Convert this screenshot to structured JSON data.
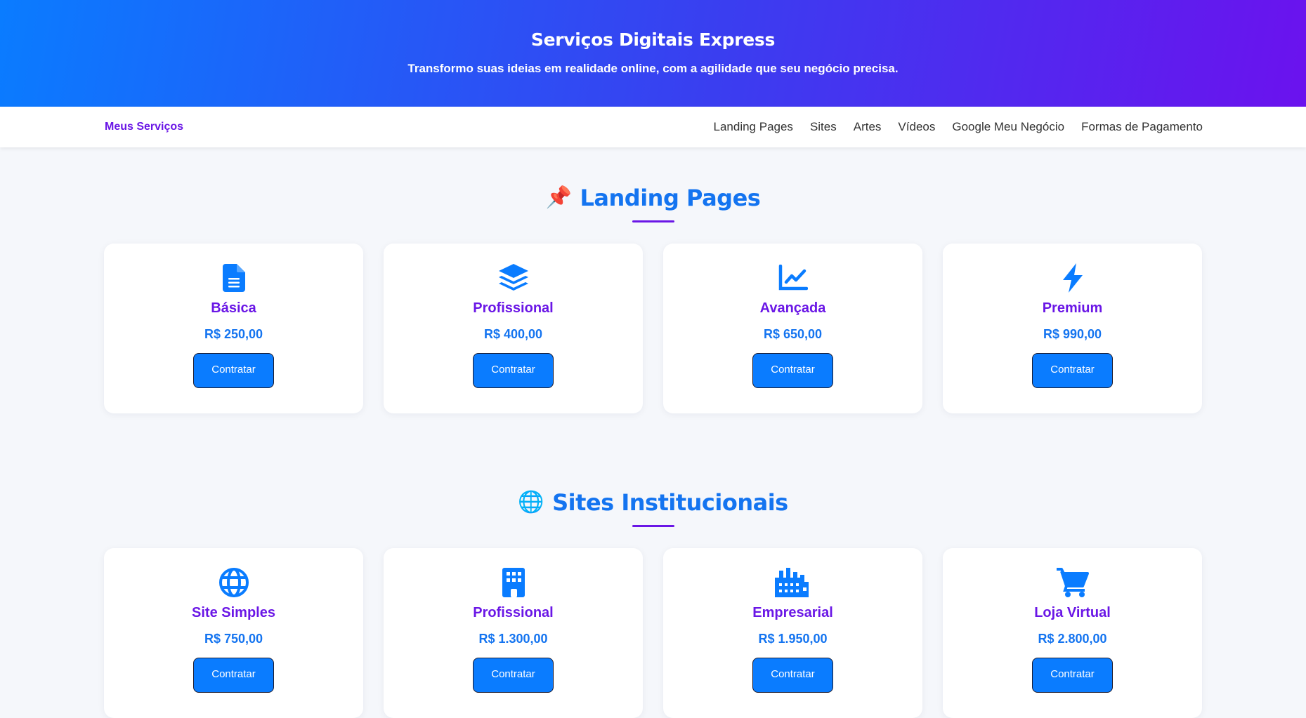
{
  "hero": {
    "title": "Serviços Digitais Express",
    "subtitle": "Transformo suas ideias em realidade online, com a agilidade que seu negócio precisa."
  },
  "nav": {
    "brand": "Meus Serviços",
    "links": [
      "Landing Pages",
      "Sites",
      "Artes",
      "Vídeos",
      "Google Meu Negócio",
      "Formas de Pagamento"
    ]
  },
  "sections": [
    {
      "emoji": "📌",
      "title": "Landing Pages",
      "cards": [
        {
          "icon": "file-icon",
          "title": "Básica",
          "price": "R$ 250,00",
          "button": "Contratar"
        },
        {
          "icon": "layers-icon",
          "title": "Profissional",
          "price": "R$ 400,00",
          "button": "Contratar"
        },
        {
          "icon": "chart-line-icon",
          "title": "Avançada",
          "price": "R$ 650,00",
          "button": "Contratar"
        },
        {
          "icon": "bolt-icon",
          "title": "Premium",
          "price": "R$ 990,00",
          "button": "Contratar"
        }
      ]
    },
    {
      "emoji": "🌐",
      "title": "Sites Institucionais",
      "cards": [
        {
          "icon": "globe-icon",
          "title": "Site Simples",
          "price": "R$ 750,00",
          "button": "Contratar"
        },
        {
          "icon": "building-icon",
          "title": "Profissional",
          "price": "R$ 1.300,00",
          "button": "Contratar"
        },
        {
          "icon": "industry-icon",
          "title": "Empresarial",
          "price": "R$ 1.950,00",
          "button": "Contratar"
        },
        {
          "icon": "cart-icon",
          "title": "Loja Virtual",
          "price": "R$ 2.800,00",
          "button": "Contratar"
        }
      ]
    }
  ],
  "colors": {
    "primary": "#0a7cff",
    "accent": "#6a16e6",
    "title_blue": "#1474f0",
    "background": "#f5f7fb"
  }
}
